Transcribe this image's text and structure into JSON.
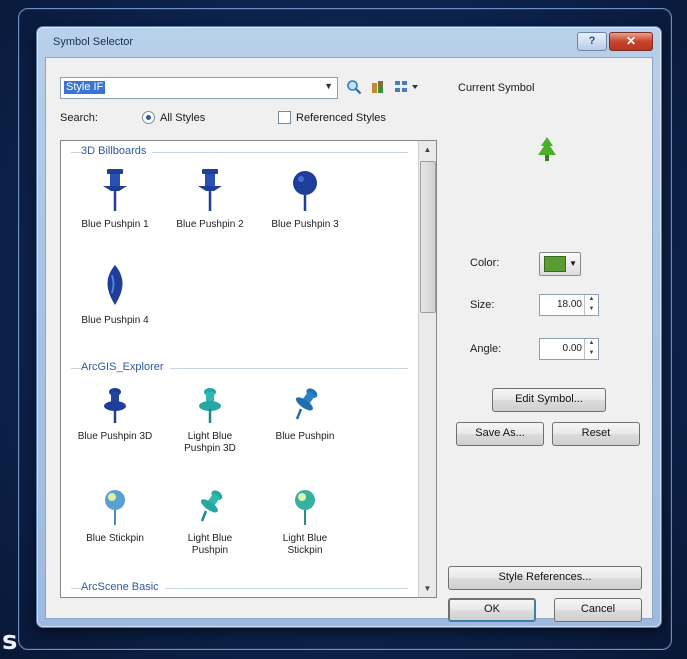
{
  "window": {
    "title": "Symbol Selector",
    "help_glyph": "?",
    "close_glyph": "✕"
  },
  "toolbar": {
    "style_combo_value": "Style IF",
    "icons": [
      "search-icon",
      "style-manager-icon",
      "view-mode-icon"
    ]
  },
  "search": {
    "label": "Search:",
    "all_styles": "All Styles",
    "referenced_styles": "Referenced Styles",
    "selected": "All Styles"
  },
  "symbol_list": {
    "groups": [
      {
        "name": "3D Billboards",
        "items": [
          {
            "label": "Blue Pushpin 1",
            "icon": "pushpin-icon",
            "color": "#1f3e9a"
          },
          {
            "label": "Blue Pushpin 2",
            "icon": "pushpin-icon",
            "color": "#1f3e9a"
          },
          {
            "label": "Blue Pushpin 3",
            "icon": "round-pin-icon",
            "color": "#1f3e9a"
          },
          {
            "label": "Blue Pushpin 4",
            "icon": "teardrop-pin-icon",
            "color": "#1f3e9a"
          }
        ]
      },
      {
        "name": "ArcGIS_Explorer",
        "items": [
          {
            "label": "Blue Pushpin 3D",
            "icon": "pushpin-3d-icon",
            "color": "#1f3e9a"
          },
          {
            "label": "Light Blue\nPushpin 3D",
            "icon": "pushpin-3d-icon",
            "color": "#27a6a6"
          },
          {
            "label": "Blue Pushpin",
            "icon": "tilted-pushpin-icon",
            "color": "#1f6fb0"
          },
          {
            "label": "Blue Stickpin",
            "icon": "stickpin-icon",
            "color": "#5aa0d0"
          },
          {
            "label": "Light Blue\nPushpin",
            "icon": "tilted-pushpin-icon",
            "color": "#27a6a6"
          },
          {
            "label": "Light Blue\nStickpin",
            "icon": "stickpin-icon",
            "color": "#36b0a0"
          }
        ]
      },
      {
        "name": "ArcScene Basic",
        "items": []
      }
    ]
  },
  "current_symbol": {
    "label": "Current Symbol",
    "icon": "tree-icon",
    "color": "#4caf2a"
  },
  "properties": {
    "color_label": "Color:",
    "color_value": "#5a9c32",
    "size_label": "Size:",
    "size_value": "18.00",
    "angle_label": "Angle:",
    "angle_value": "0.00"
  },
  "buttons": {
    "edit_symbol": "Edit Symbol...",
    "save_as": "Save As...",
    "reset": "Reset",
    "style_references": "Style References...",
    "ok": "OK",
    "cancel": "Cancel"
  }
}
